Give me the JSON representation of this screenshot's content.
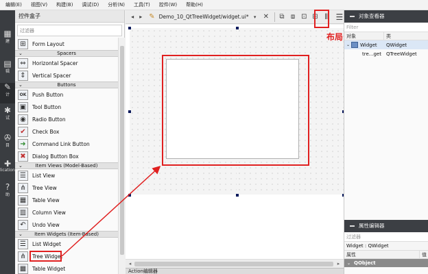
{
  "menubar": {
    "items": [
      "编辑(E)",
      "视图(V)",
      "构建(B)",
      "调试(D)",
      "分析(N)",
      "工具(T)",
      "控件(W)",
      "帮助(H)"
    ]
  },
  "modebar": {
    "items": [
      {
        "label": "建",
        "icon": "grid-icon"
      },
      {
        "label": "辑",
        "icon": "document-icon"
      },
      {
        "label": "计",
        "icon": "pen-icon"
      },
      {
        "label": "试",
        "icon": "bug-icon"
      },
      {
        "label": "目",
        "icon": "wrench-icon"
      },
      {
        "label": "lications",
        "icon": "plus-icon"
      },
      {
        "label": "助",
        "icon": "help-icon"
      }
    ]
  },
  "widgetbox": {
    "title": "控件盒子",
    "filter_placeholder": "过滤器",
    "categories": [
      {
        "name": "",
        "items": [
          {
            "label": "Form Layout",
            "icon": "⊞"
          }
        ]
      },
      {
        "name": "Spacers",
        "items": [
          {
            "label": "Horizontal Spacer",
            "icon": "⇔"
          },
          {
            "label": "Vertical Spacer",
            "icon": "⇕"
          }
        ]
      },
      {
        "name": "Buttons",
        "items": [
          {
            "label": "Push Button",
            "icon": "OK"
          },
          {
            "label": "Tool Button",
            "icon": "▣"
          },
          {
            "label": "Radio Button",
            "icon": "◉"
          },
          {
            "label": "Check Box",
            "icon": "✔"
          },
          {
            "label": "Command Link Button",
            "icon": "➜"
          },
          {
            "label": "Dialog Button Box",
            "icon": "✖"
          }
        ]
      },
      {
        "name": "Item Views (Model-Based)",
        "items": [
          {
            "label": "List View",
            "icon": "☰"
          },
          {
            "label": "Tree View",
            "icon": "⋔"
          },
          {
            "label": "Table View",
            "icon": "▦"
          },
          {
            "label": "Column View",
            "icon": "▥"
          },
          {
            "label": "Undo View",
            "icon": "↶"
          }
        ]
      },
      {
        "name": "Item Widgets (Item-Based)",
        "items": [
          {
            "label": "List Widget",
            "icon": "☰"
          },
          {
            "label": "Tree Widget",
            "icon": "⋔"
          },
          {
            "label": "Table Widget",
            "icon": "▦"
          }
        ]
      }
    ]
  },
  "editor": {
    "file_title": "Demo_10_QtTreeWidget/widget.ui*",
    "layout_annotation": "布局",
    "action_editor_label": "Action编辑器"
  },
  "object_inspector": {
    "title": "对象查看器",
    "filter_placeholder": "Filter",
    "columns": [
      "对象",
      "类"
    ],
    "rows": [
      {
        "object": "Widget",
        "class": "QWidget",
        "level": 0,
        "selected": true
      },
      {
        "object": "tre...get",
        "class": "QTreeWidget",
        "level": 1,
        "selected": false
      }
    ]
  },
  "property_editor": {
    "title": "属性编辑器",
    "filter_placeholder": "过滤器",
    "object_line": "Widget : QWidget",
    "columns": [
      "属性",
      "值"
    ],
    "group": "QObject"
  },
  "colors": {
    "annotation_red": "#e02020",
    "selection_blue": "#dbe7f6"
  }
}
